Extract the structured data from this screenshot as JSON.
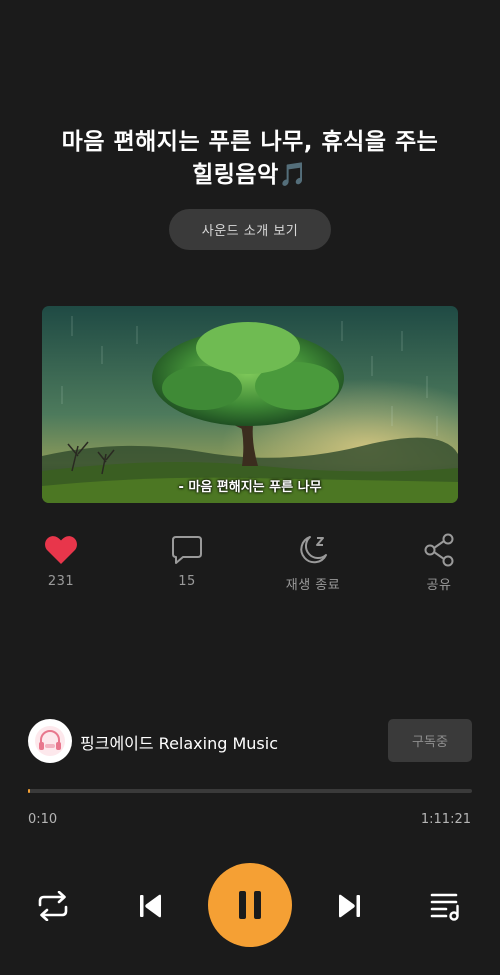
{
  "track": {
    "title_line1": "마음 편해지는 푸른 나무, 휴식을 주는",
    "title_line2": "힐링음악",
    "title_emoji": "🎵",
    "cover_caption": "- 마음 편해지는 푸른 나무"
  },
  "sound_intro_label": "사운드 소개 보기",
  "actions": {
    "like": {
      "icon": "heart-icon",
      "label": "231",
      "color": "#e8364b"
    },
    "comment": {
      "icon": "comment-icon",
      "label": "15"
    },
    "sleep_timer": {
      "icon": "moon-sleep-icon",
      "label": "재생 종료"
    },
    "share": {
      "icon": "share-icon",
      "label": "공유"
    }
  },
  "channel": {
    "name": "핑크에이드 Relaxing Music",
    "subscribe_label": "구독중"
  },
  "player": {
    "current_time": "0:10",
    "total_time": "1:11:21",
    "progress_fraction": 0.0023,
    "state": "playing",
    "accent_color": "#f5a034"
  }
}
